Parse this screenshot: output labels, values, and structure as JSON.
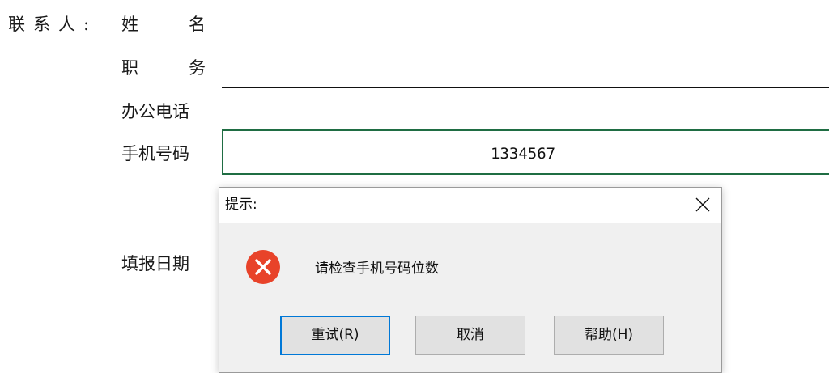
{
  "form": {
    "contact_label": "联系人:",
    "name_label": "姓名",
    "title_label": "职务",
    "office_phone_label": "办公电话",
    "mobile_label": "手机号码",
    "mobile_value": "1334567",
    "fill_date_label": "填报日期"
  },
  "dialog": {
    "title": "提示:",
    "message": "请检查手机号码位数",
    "buttons": {
      "retry": "重试(R)",
      "cancel": "取消",
      "help": "帮助(H)"
    },
    "colors": {
      "error_icon": "#e8432a",
      "default_button_border": "#0078d7"
    }
  },
  "colors": {
    "selected_field_border": "#1f6d43"
  }
}
